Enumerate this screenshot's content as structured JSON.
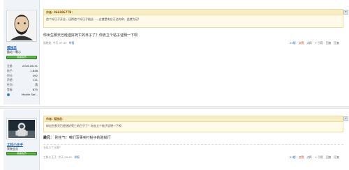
{
  "posts": [
    {
      "username": "孤独恋",
      "user_title": "酷站一颗心",
      "rank_label": "高级会员",
      "stats": [
        {
          "label": "注册:",
          "value": "2016-08-31"
        },
        {
          "label": "帖子:",
          "value": "1,848"
        },
        {
          "label": "积分:",
          "value": "492"
        },
        {
          "label": "声望:",
          "value": "111"
        },
        {
          "label": "性别:",
          "value": "男"
        },
        {
          "label": "等级:",
          "value": "875"
        },
        {
          "label": "",
          "value": "Mobile Saf..."
        }
      ],
      "quote_author": "作者: 0668867TB：",
      "quote_text": "造个好日子开业，还得造个好日子结业......过就是电台万达的命，此就为证!",
      "message": "你出生那天已经选好死亡的日子了？你去立个帖子证明一下呗",
      "footer_user": "孤独恋",
      "footer_time": "今天 07:40",
      "footer_report": "举报",
      "footer_actions": [
        "24楼",
        "点赞",
        "点踩",
        "+ 引用",
        "回复",
        "回复"
      ]
    },
    {
      "username": "工科小王子",
      "user_title": "荣誉会员",
      "rank_label": "高级会员",
      "quote_author": "作者: 孤独恋：",
      "quote_text": "你出生那天已经选好死亡的日子了？你去立个帖子证明一下呗",
      "message_bold": "跳兄",
      "message": "别生气！咱们写事实打帖子的验就行",
      "signature": "长征三个无聊？",
      "footer_user": "工科小王子",
      "footer_time": "今天 09:41",
      "footer_report": "举报",
      "footer_actions": [
        "25楼",
        "点赞",
        "点踩",
        "+ 引用",
        "回复",
        "回复"
      ]
    }
  ]
}
